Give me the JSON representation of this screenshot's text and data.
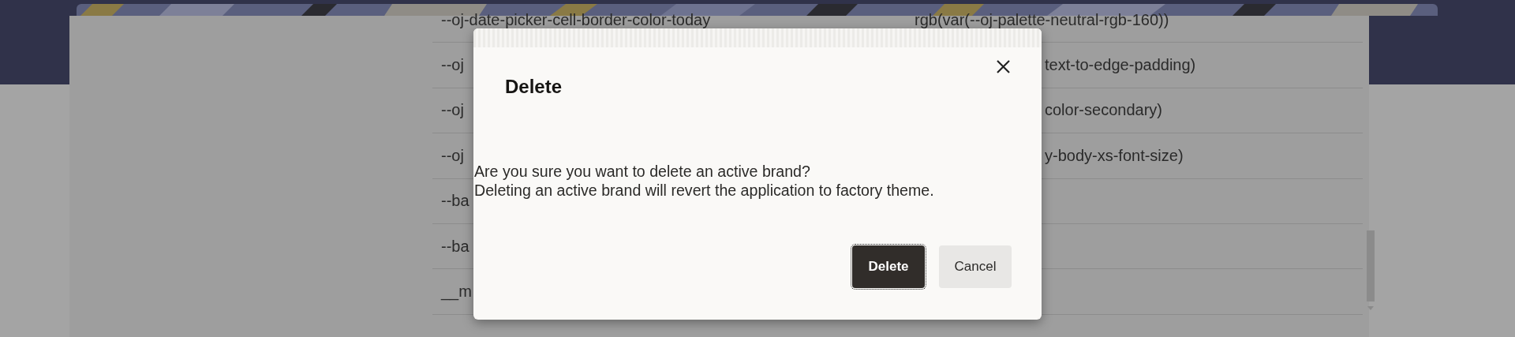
{
  "table": {
    "rows": [
      {
        "name": "--oj-date-picker-cell-border-color-today",
        "value": "rgb(var(--oj-palette-neutral-rgb-160))"
      },
      {
        "name": "--oj",
        "value": "text-to-edge-padding)"
      },
      {
        "name": "--oj",
        "value": "color-secondary)"
      },
      {
        "name": "--oj",
        "value": "y-body-xs-font-size)"
      },
      {
        "name": "--ba"
      },
      {
        "name": "--ba"
      },
      {
        "name": "__m"
      }
    ]
  },
  "dialog": {
    "title": "Delete",
    "message": [
      "Are you sure you want to delete an active brand?",
      "Deleting an active brand will revert the application to factory theme."
    ],
    "buttons": [
      {
        "label": "Delete",
        "kind": "primary",
        "focused": true
      },
      {
        "label": "Cancel",
        "kind": "secondary",
        "focused": false
      }
    ]
  }
}
